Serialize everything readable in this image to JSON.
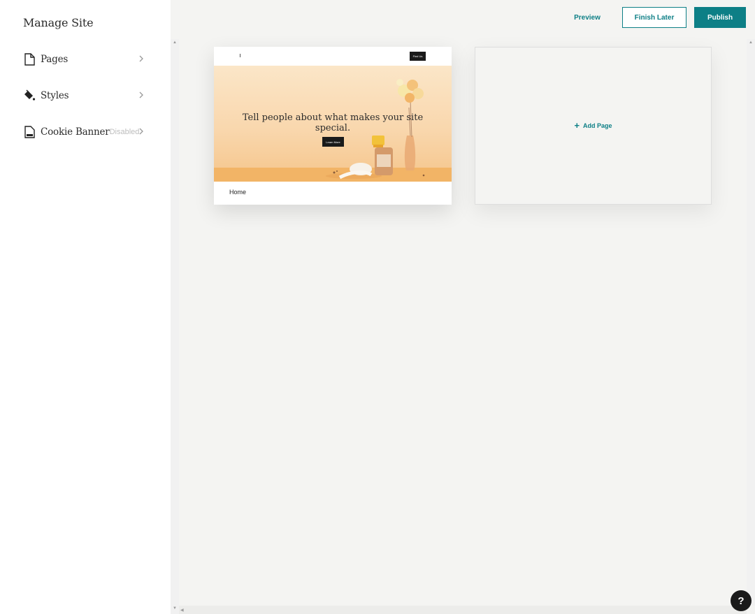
{
  "sidebar": {
    "title": "Manage Site",
    "items": [
      {
        "label": "Pages",
        "icon": "page-icon",
        "status": ""
      },
      {
        "label": "Styles",
        "icon": "paint-bucket-icon",
        "status": ""
      },
      {
        "label": "Cookie Banner",
        "icon": "cookie-banner-icon",
        "status": "Disabled"
      }
    ]
  },
  "toolbar": {
    "preview_label": "Preview",
    "finish_later_label": "Finish Later",
    "publish_label": "Publish"
  },
  "pages": [
    {
      "name": "Home",
      "preview": {
        "nav_cta": "Find Us",
        "headline": "Tell people about what makes your site special.",
        "button_label": "Learn More"
      }
    }
  ],
  "add_page_label": "Add Page",
  "help_label": "?",
  "colors": {
    "accent": "#0d7f86",
    "sidebar_bg": "#ffffff",
    "canvas_bg": "#f4f4f2",
    "help_bg": "#1a1a1a"
  }
}
